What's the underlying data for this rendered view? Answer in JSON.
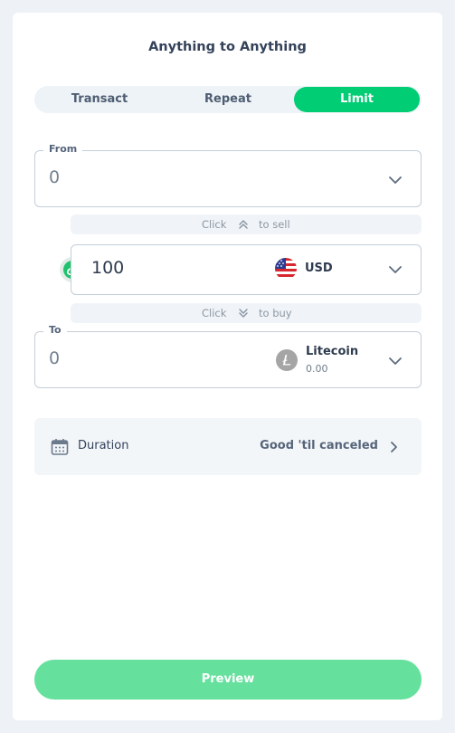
{
  "header": {
    "title": "Anything to Anything"
  },
  "tabs": [
    {
      "label": "Transact",
      "active": false
    },
    {
      "label": "Repeat",
      "active": false
    },
    {
      "label": "Limit",
      "active": true
    }
  ],
  "from": {
    "label": "From",
    "amount": "0"
  },
  "sell_hint": {
    "prefix": "Click",
    "suffix": "to sell"
  },
  "input": {
    "amount": "100",
    "currency": "USD",
    "currency_icon": "us-flag-icon"
  },
  "buy_hint": {
    "prefix": "Click",
    "suffix": "to buy"
  },
  "to": {
    "label": "To",
    "amount": "0",
    "asset_name": "Litecoin",
    "asset_balance": "0.00",
    "asset_icon": "litecoin-icon"
  },
  "duration": {
    "label": "Duration",
    "value": "Good 'til canceled"
  },
  "actions": {
    "preview_label": "Preview"
  },
  "colors": {
    "accent": "#00cd74",
    "preview_button": "#66e09d",
    "border": "#c3ced9"
  }
}
